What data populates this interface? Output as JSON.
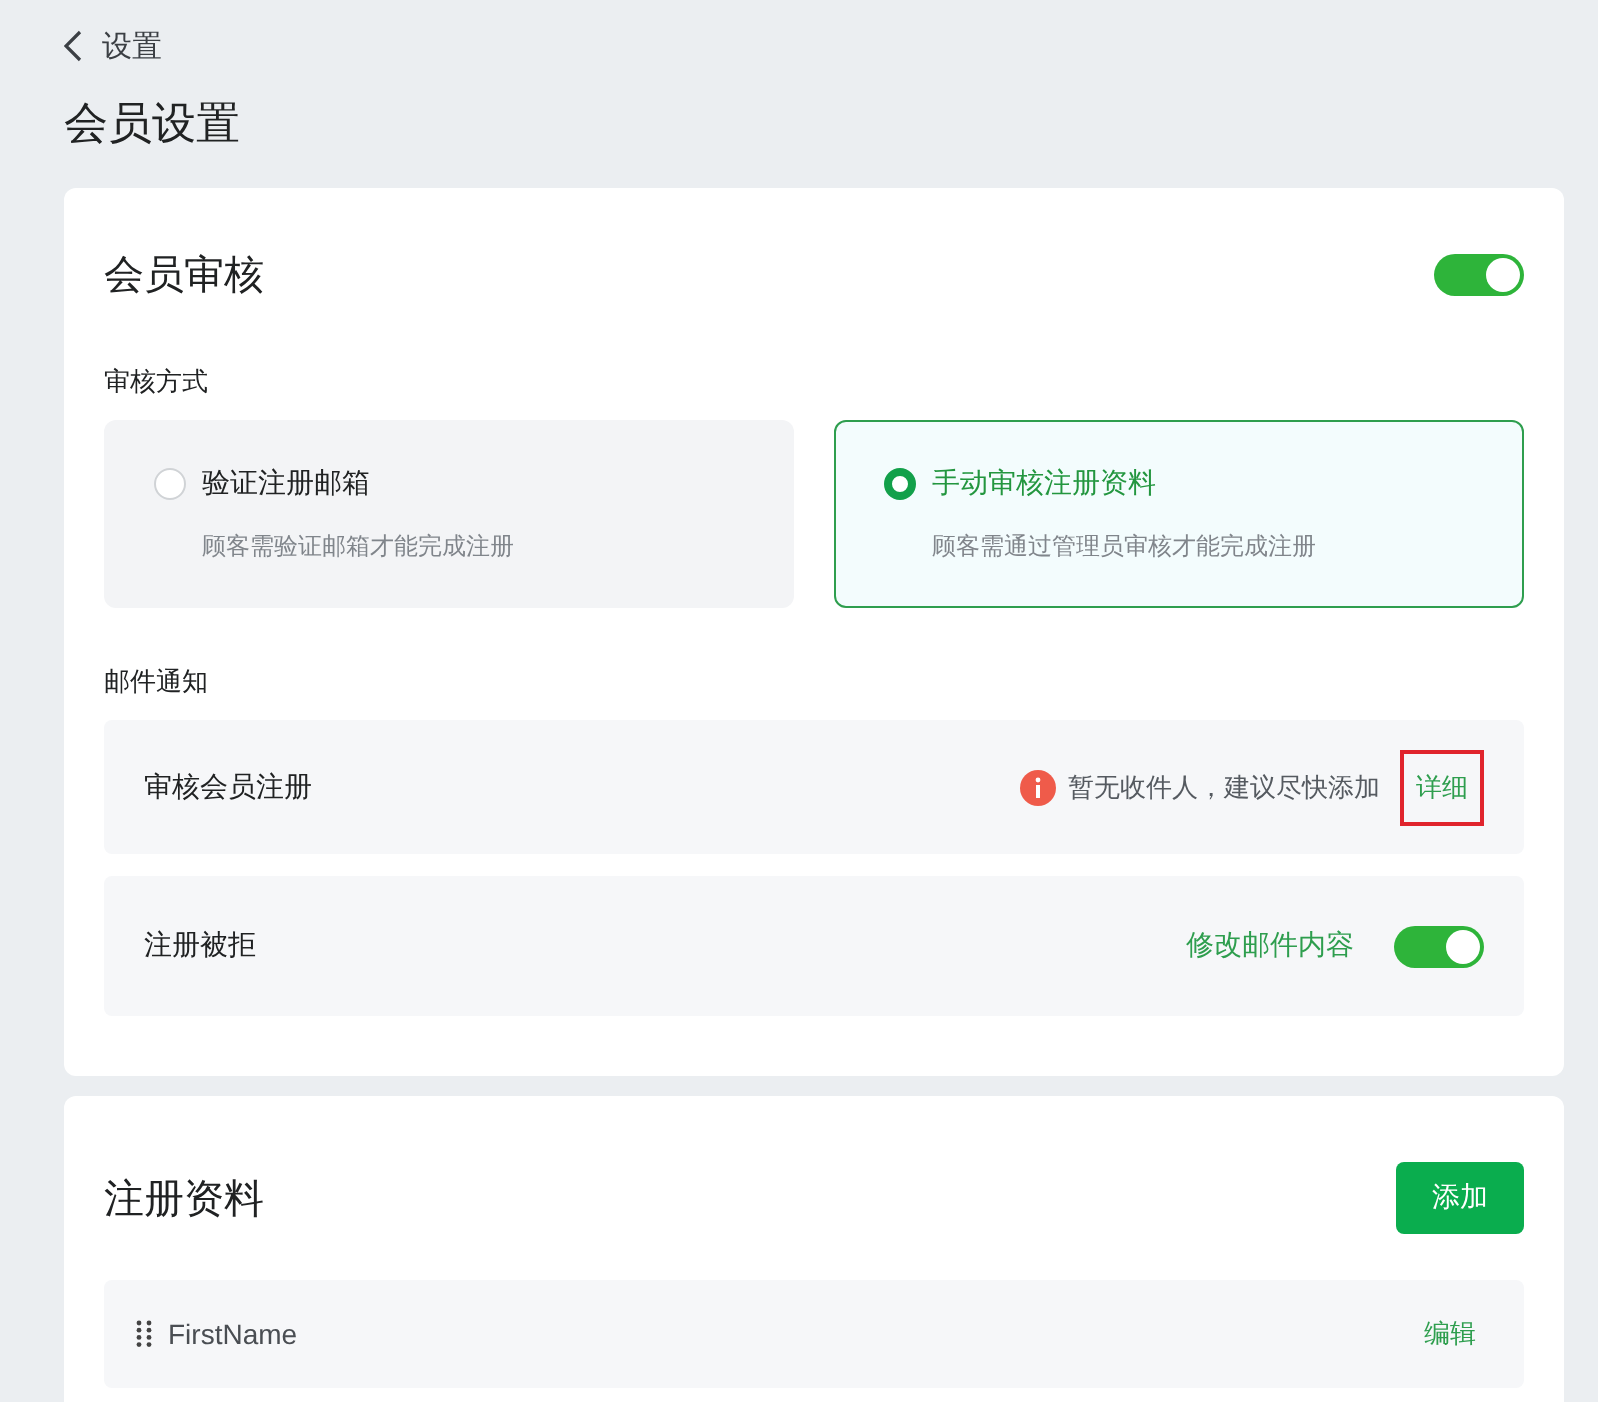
{
  "back": {
    "label": "设置"
  },
  "page_title": "会员设置",
  "review": {
    "title": "会员审核",
    "on": true,
    "method_label": "审核方式",
    "options": [
      {
        "label": "验证注册邮箱",
        "description": "顾客需验证邮箱才能完成注册",
        "selected": false
      },
      {
        "label": "手动审核注册资料",
        "description": "顾客需通过管理员审核才能完成注册",
        "selected": true
      }
    ],
    "mail_label": "邮件通知",
    "mail_rows": [
      {
        "kind": "warning",
        "name": "审核会员注册",
        "warning": "暂无收件人，建议尽快添加",
        "link": "详细",
        "highlighted": true
      },
      {
        "kind": "toggle",
        "name": "注册被拒",
        "link": "修改邮件内容",
        "on": true
      }
    ]
  },
  "fields": {
    "title": "注册资料",
    "add_button": "添加",
    "rows": [
      {
        "name": "FirstName",
        "action": "编辑"
      }
    ]
  }
}
